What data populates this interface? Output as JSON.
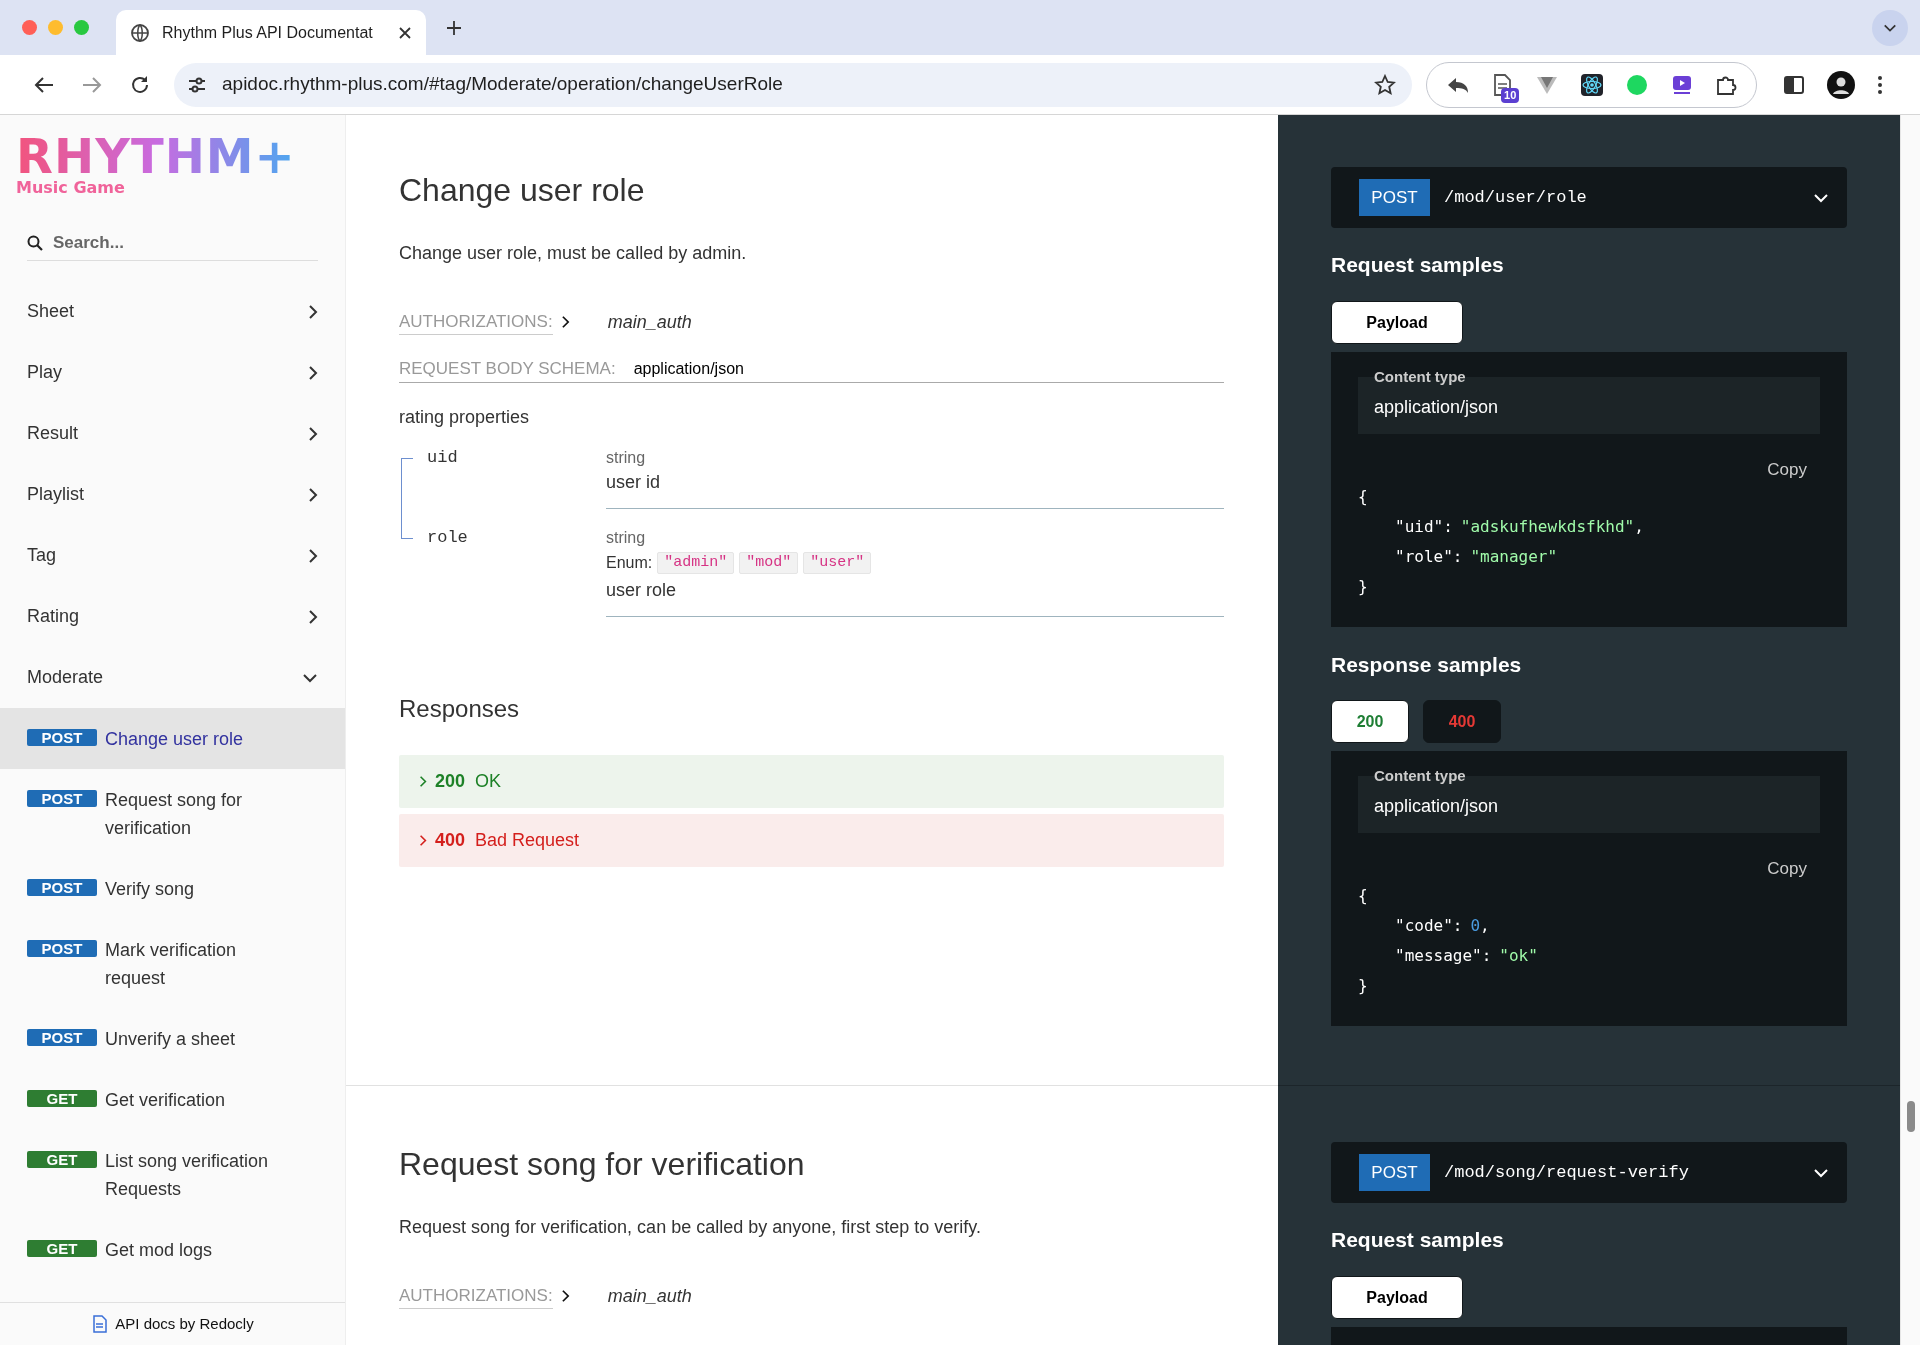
{
  "browser": {
    "tab_title": "Rhythm Plus API Documentat",
    "url": "apidoc.rhythm-plus.com/#tag/Moderate/operation/changeUserRole",
    "extension_badge": "10"
  },
  "sidebar": {
    "logo": {
      "wordmark": "RHYTHM+",
      "tagline": "Music Game"
    },
    "search": {
      "placeholder": "Search..."
    },
    "items": [
      {
        "label": "Sheet",
        "expanded": false
      },
      {
        "label": "Play",
        "expanded": false
      },
      {
        "label": "Result",
        "expanded": false
      },
      {
        "label": "Playlist",
        "expanded": false
      },
      {
        "label": "Tag",
        "expanded": false
      },
      {
        "label": "Rating",
        "expanded": false
      },
      {
        "label": "Moderate",
        "expanded": true,
        "children": [
          {
            "method": "POST",
            "color": "#1f6cb5",
            "label": "Change user role",
            "selected": true
          },
          {
            "method": "POST",
            "color": "#1f6cb5",
            "label": "Request song for verification",
            "selected": false
          },
          {
            "method": "POST",
            "color": "#1f6cb5",
            "label": "Verify song",
            "selected": false
          },
          {
            "method": "POST",
            "color": "#1f6cb5",
            "label": "Mark verification request",
            "selected": false
          },
          {
            "method": "POST",
            "color": "#1f6cb5",
            "label": "Unverify a sheet",
            "selected": false
          },
          {
            "method": "GET",
            "color": "#2e7d32",
            "label": "Get verification",
            "selected": false
          },
          {
            "method": "GET",
            "color": "#2e7d32",
            "label": "List song verification Requests",
            "selected": false
          },
          {
            "method": "GET",
            "color": "#2e7d32",
            "label": "Get mod logs",
            "selected": false
          }
        ]
      }
    ],
    "footer": "API docs by Redocly"
  },
  "operations": [
    {
      "title": "Change user role",
      "description": "Change user role, must be called by admin.",
      "authorizations": {
        "label": "AUTHORIZATIONS:",
        "value": "main_auth"
      },
      "body_schema": {
        "label": "REQUEST BODY SCHEMA:",
        "value": "application/json"
      },
      "properties_title": "rating properties",
      "properties": [
        {
          "name": "uid",
          "type": "string",
          "description": "user id"
        },
        {
          "name": "role",
          "type": "string",
          "enum_label": "Enum:",
          "enum": [
            "\"admin\"",
            "\"mod\"",
            "\"user\""
          ],
          "description": "user role"
        }
      ],
      "responses_title": "Responses",
      "responses": [
        {
          "code": "200",
          "text": "OK",
          "kind": "success"
        },
        {
          "code": "400",
          "text": "Bad Request",
          "kind": "error"
        }
      ],
      "sample": {
        "method": "POST",
        "color": "#1f6cb5",
        "path": "/mod/user/role",
        "request_title": "Request samples",
        "request_tabs": [
          {
            "label": "Payload",
            "selected": true
          }
        ],
        "request_body": {
          "content_type_label": "Content type",
          "content_type": "application/json",
          "copy": "Copy",
          "open": "{",
          "close": "}",
          "members": [
            {
              "key": "\"uid\":",
              "value": "\"adskufhewkdsfkhd\"",
              "color": "#a0fbaa",
              "after": ","
            },
            {
              "key": "\"role\":",
              "value": "\"manager\"",
              "color": "#a0fbaa"
            }
          ]
        },
        "response_title": "Response samples",
        "response_tabs": [
          {
            "label": "200",
            "kind": "success",
            "selected": true
          },
          {
            "label": "400",
            "kind": "error",
            "selected": false
          }
        ],
        "response_body": {
          "content_type_label": "Content type",
          "content_type": "application/json",
          "copy": "Copy",
          "open": "{",
          "close": "}",
          "members": [
            {
              "key": "\"code\":",
              "value": "0",
              "color": "#4a9be0",
              "after": ","
            },
            {
              "key": "\"message\":",
              "value": "\"ok\"",
              "color": "#a0fbaa"
            }
          ]
        }
      }
    },
    {
      "title": "Request song for verification",
      "description": "Request song for verification, can be called by anyone, first step to verify.",
      "authorizations": {
        "label": "AUTHORIZATIONS:",
        "value": "main_auth"
      },
      "sample": {
        "method": "POST",
        "color": "#1f6cb5",
        "path": "/mod/song/request-verify",
        "request_title": "Request samples",
        "request_tabs": [
          {
            "label": "Payload",
            "selected": true
          }
        ]
      }
    }
  ]
}
